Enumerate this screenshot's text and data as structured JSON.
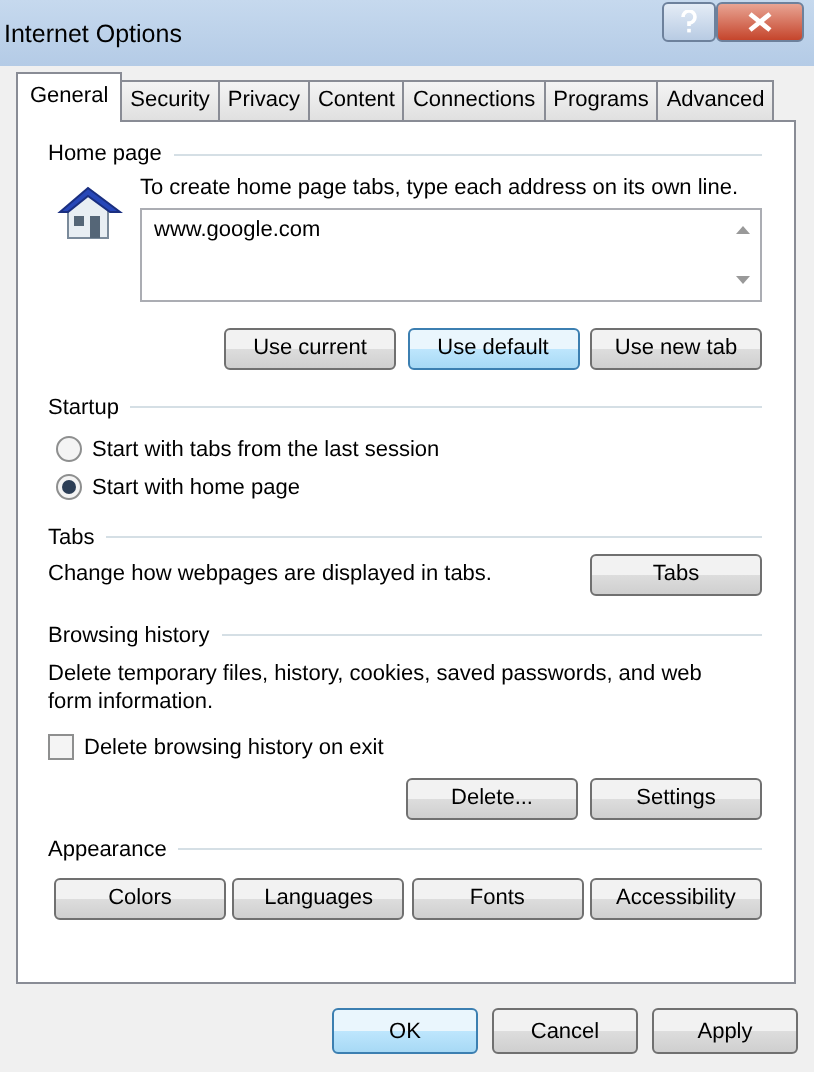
{
  "window": {
    "title": "Internet Options"
  },
  "tabs": [
    {
      "label": "General",
      "selected": true
    },
    {
      "label": "Security",
      "selected": false
    },
    {
      "label": "Privacy",
      "selected": false
    },
    {
      "label": "Content",
      "selected": false
    },
    {
      "label": "Connections",
      "selected": false
    },
    {
      "label": "Programs",
      "selected": false
    },
    {
      "label": "Advanced",
      "selected": false
    }
  ],
  "home_page": {
    "heading": "Home page",
    "hint": "To create home page tabs, type each address on its own line.",
    "address": "www.google.com",
    "buttons": [
      {
        "label": "Use current",
        "highlighted": false
      },
      {
        "label": "Use default",
        "highlighted": true
      },
      {
        "label": "Use new tab",
        "highlighted": false
      }
    ]
  },
  "startup": {
    "heading": "Startup",
    "options": [
      {
        "label": "Start with tabs from the last session",
        "selected": false
      },
      {
        "label": "Start with home page",
        "selected": true
      }
    ]
  },
  "tabs_section": {
    "heading": "Tabs",
    "text": "Change how webpages are displayed in tabs.",
    "button": "Tabs"
  },
  "browsing_history": {
    "heading": "Browsing history",
    "text": "Delete temporary files, history, cookies, saved passwords, and web form information.",
    "delete_on_exit": {
      "label": "Delete browsing history on exit",
      "checked": false
    },
    "buttons": [
      {
        "label": "Delete...",
        "highlighted": false
      },
      {
        "label": "Settings",
        "highlighted": false
      }
    ]
  },
  "appearance": {
    "heading": "Appearance",
    "buttons": [
      {
        "label": "Colors",
        "highlighted": false
      },
      {
        "label": "Languages",
        "highlighted": false
      },
      {
        "label": "Fonts",
        "highlighted": false
      },
      {
        "label": "Accessibility",
        "highlighted": false
      }
    ]
  },
  "footer_buttons": [
    {
      "label": "OK",
      "highlighted": true
    },
    {
      "label": "Cancel",
      "highlighted": false
    },
    {
      "label": "Apply",
      "highlighted": false
    }
  ]
}
